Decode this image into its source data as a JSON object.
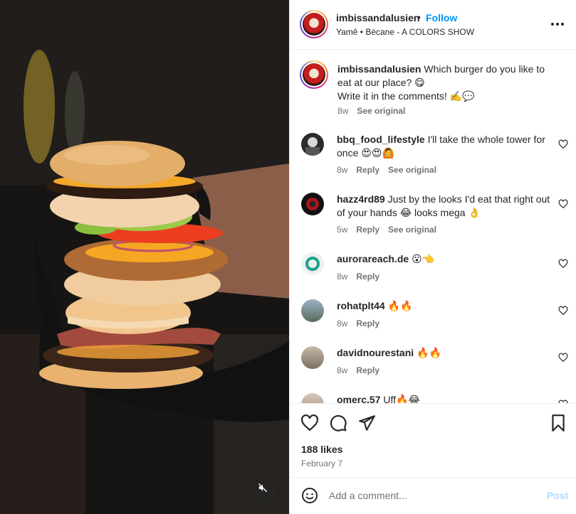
{
  "header": {
    "username": "imbissandalusien",
    "separator": "•",
    "follow_label": "Follow",
    "audio": "Yamê • Bécane - A COLORS SHOW"
  },
  "caption": {
    "username": "imbissandalusien",
    "line1": "Which burger do you like to eat at our place? 😋",
    "line2": "Write it in the comments! ✍️💬",
    "time": "8w",
    "see_original": "See original"
  },
  "comments": [
    {
      "username": "bbq_food_lifestyle",
      "text": "I'll take the whole tower for once 😍😍🙆",
      "time": "8w",
      "reply": "Reply",
      "see_original": "See original"
    },
    {
      "username": "hazz4rd89",
      "text": "Just by the looks I'd eat that right out of your hands 😂 looks mega 👌",
      "time": "5w",
      "reply": "Reply",
      "see_original": "See original"
    },
    {
      "username": "aurorareach.de",
      "text": "😮👈",
      "time": "8w",
      "reply": "Reply"
    },
    {
      "username": "rohatplt44",
      "text": "🔥🔥",
      "time": "8w",
      "reply": "Reply"
    },
    {
      "username": "davidnourestani",
      "text": "🔥🔥",
      "time": "8w",
      "reply": "Reply"
    },
    {
      "username": "omerc.57",
      "text": "Uff🔥😂",
      "time": "",
      "reply": ""
    }
  ],
  "stats": {
    "likes": "188 likes",
    "date": "February 7"
  },
  "composer": {
    "placeholder": "Add a comment...",
    "post_label": "Post"
  },
  "icons": {
    "more": "more-horizontal-icon",
    "like": "heart-icon",
    "comment": "comment-icon",
    "share": "share-icon",
    "save": "bookmark-icon",
    "emoji": "emoji-icon",
    "mute": "speaker-muted-icon"
  },
  "colors": {
    "accent": "#0095f6",
    "muted_text": "#737373",
    "post_disabled": "#b3dbff"
  }
}
